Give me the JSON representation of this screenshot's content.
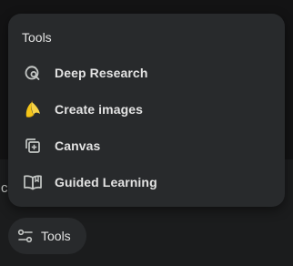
{
  "menu": {
    "heading": "Tools",
    "items": [
      {
        "label": "Deep Research",
        "icon": "deep-research-icon"
      },
      {
        "label": "Create images",
        "icon": "banana-icon"
      },
      {
        "label": "Canvas",
        "icon": "canvas-icon"
      },
      {
        "label": "Guided Learning",
        "icon": "book-icon"
      }
    ]
  },
  "toolbar": {
    "tools_label": "Tools",
    "tools_icon": "tune-sliders-icon"
  },
  "colors": {
    "background": "#1b1c1d",
    "surface": "#282a2c",
    "text": "#e3e3e3",
    "icon": "#c4c7c5",
    "banana_yellow": "#f5c518"
  }
}
